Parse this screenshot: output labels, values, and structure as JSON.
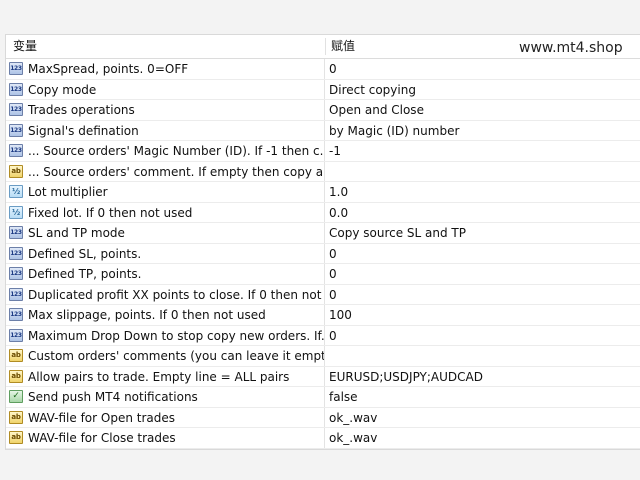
{
  "header": {
    "variable_col": "变量",
    "value_col": "赋值"
  },
  "watermark": "www.mt4.shop",
  "rows": [
    {
      "icon": "num",
      "icon_glyph": "123",
      "label": "MaxSpread, points. 0=OFF",
      "value": "0"
    },
    {
      "icon": "num",
      "icon_glyph": "123",
      "label": "Copy mode",
      "value": "Direct copying"
    },
    {
      "icon": "num",
      "icon_glyph": "123",
      "label": "Trades operations",
      "value": "Open and Close"
    },
    {
      "icon": "num",
      "icon_glyph": "123",
      "label": "Signal's defination",
      "value": "by Magic (ID) number"
    },
    {
      "icon": "num",
      "icon_glyph": "123",
      "label": "... Source orders' Magic Number (ID). If -1 then c...",
      "value": "-1"
    },
    {
      "icon": "text",
      "icon_glyph": "ab",
      "label": "... Source orders' comment. If empty then copy all...",
      "value": ""
    },
    {
      "icon": "frac",
      "icon_glyph": "½",
      "label": "Lot multiplier",
      "value": "1.0"
    },
    {
      "icon": "frac",
      "icon_glyph": "½",
      "label": "Fixed lot. If 0 then not used",
      "value": "0.0"
    },
    {
      "icon": "num",
      "icon_glyph": "123",
      "label": "SL and TP mode",
      "value": "Copy source SL and TP"
    },
    {
      "icon": "num",
      "icon_glyph": "123",
      "label": "Defined SL, points.",
      "value": "0"
    },
    {
      "icon": "num",
      "icon_glyph": "123",
      "label": "Defined TP, points.",
      "value": "0"
    },
    {
      "icon": "num",
      "icon_glyph": "123",
      "label": "Duplicated profit XX points to close. If 0 then not ...",
      "value": "0"
    },
    {
      "icon": "num",
      "icon_glyph": "123",
      "label": "Max slippage, points. If 0 then not used",
      "value": "100"
    },
    {
      "icon": "num",
      "icon_glyph": "123",
      "label": "Maximum Drop Down to stop copy new orders. If...",
      "value": "0"
    },
    {
      "icon": "text",
      "icon_glyph": "ab",
      "label": "Custom orders' comments (you can leave it empty)",
      "value": ""
    },
    {
      "icon": "text",
      "icon_glyph": "ab",
      "label": "Allow pairs to trade. Empty line = ALL pairs",
      "value": "EURUSD;USDJPY;AUDCAD"
    },
    {
      "icon": "bool",
      "icon_glyph": "✓",
      "label": "Send push MT4 notifications",
      "value": "false"
    },
    {
      "icon": "text",
      "icon_glyph": "ab",
      "label": "WAV-file for Open trades",
      "value": "ok_.wav"
    },
    {
      "icon": "text",
      "icon_glyph": "ab",
      "label": "WAV-file for Close trades",
      "value": "ok_.wav"
    }
  ]
}
